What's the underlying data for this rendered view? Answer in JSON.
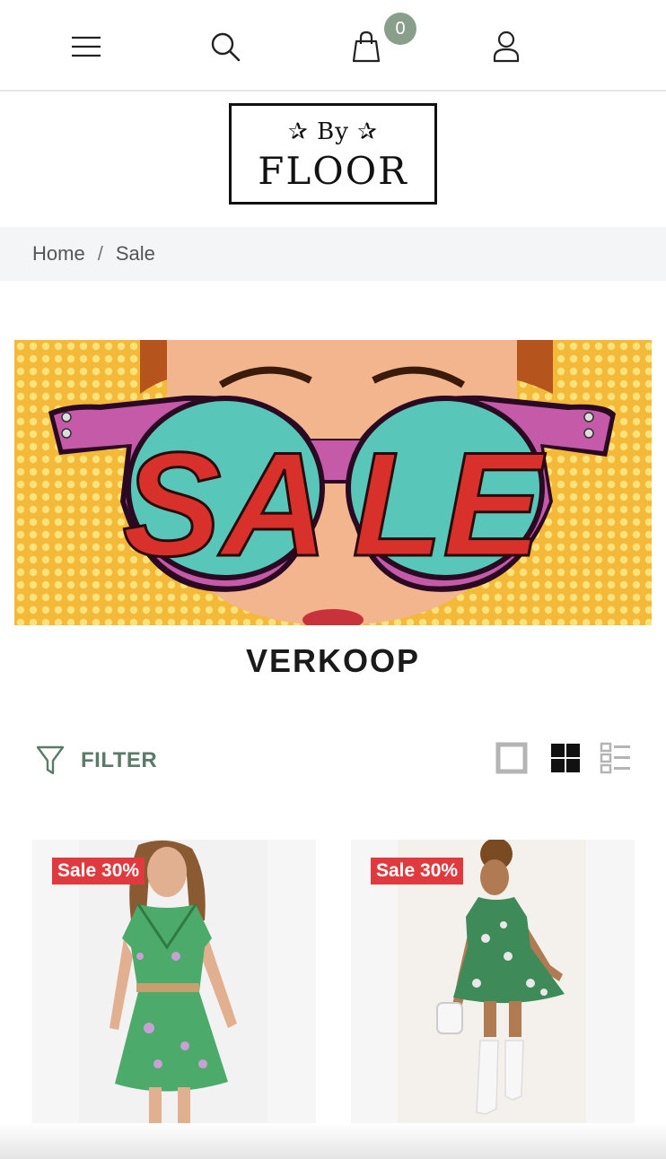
{
  "header": {
    "cart_count": "0",
    "icons": [
      "menu-icon",
      "search-icon",
      "shopping-bag-icon",
      "user-icon"
    ]
  },
  "logo": {
    "top_text": "✰ By ✰",
    "main_text": "FLOOR"
  },
  "breadcrumb": {
    "home": "Home",
    "separator": "/",
    "current": "Sale"
  },
  "banner": {
    "text_left": "SA",
    "text_right": "LE"
  },
  "page": {
    "title": "VERKOOP"
  },
  "toolbar": {
    "filter_label": "FILTER",
    "view_modes": [
      "single-view-icon",
      "grid-view-icon",
      "list-view-icon"
    ],
    "active_view": "grid"
  },
  "products": [
    {
      "badge": "Sale 30%"
    },
    {
      "badge": "Sale 30%"
    }
  ],
  "colors": {
    "badge_bg": "#e03a3e",
    "cart_badge": "#8a9e8c",
    "filter_text": "#5c7a68",
    "breadcrumb_bg": "#f4f5f7"
  }
}
